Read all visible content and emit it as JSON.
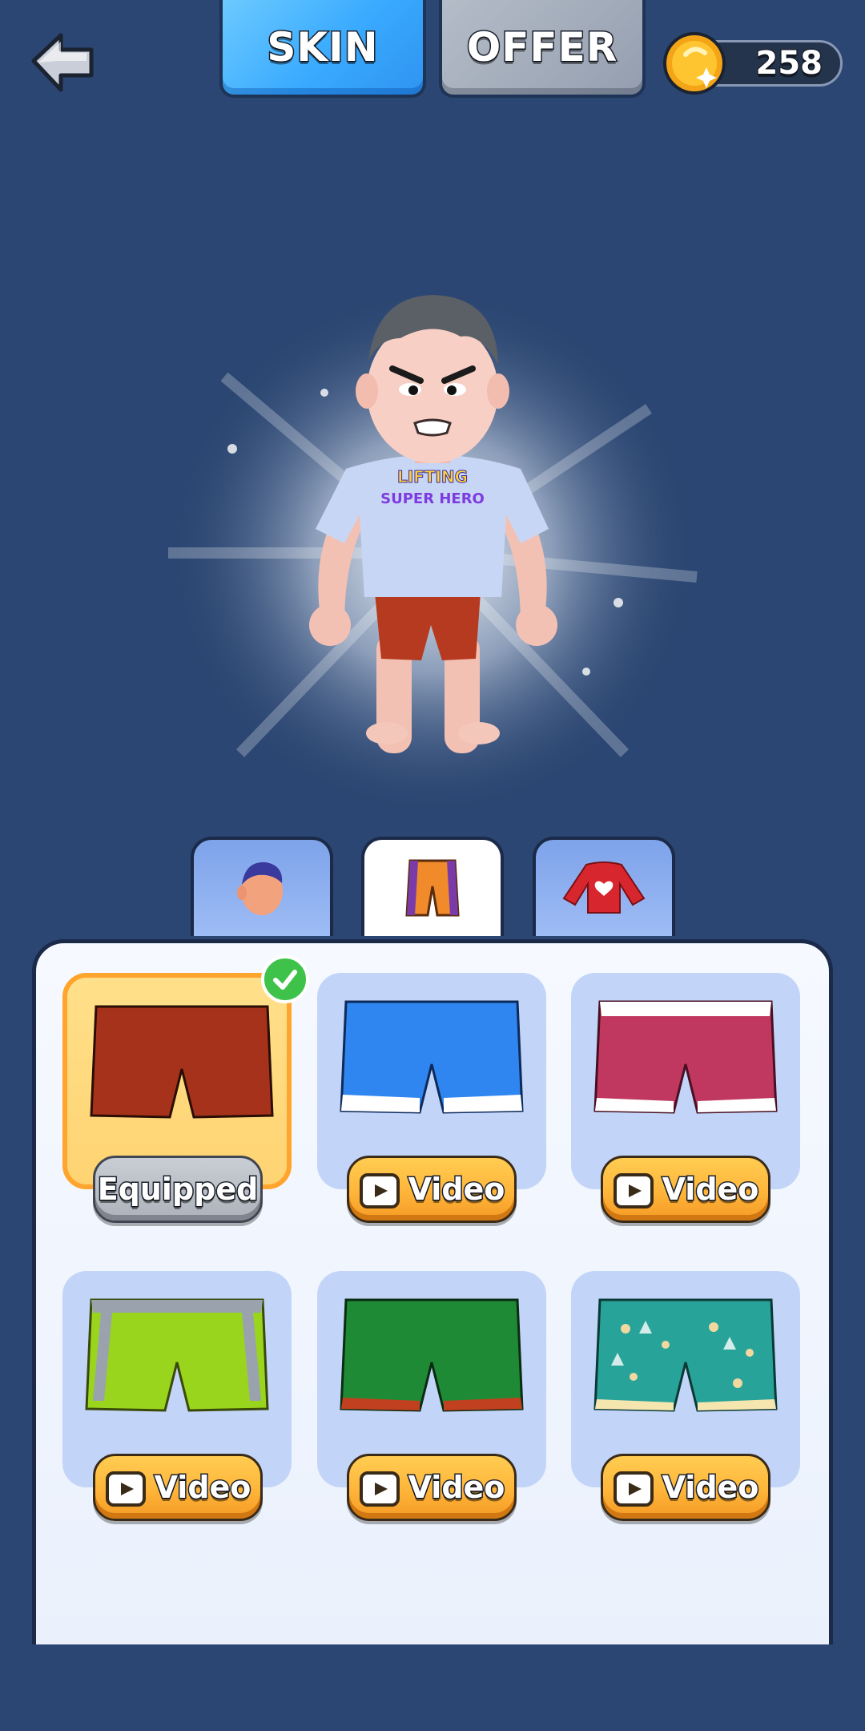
{
  "header": {
    "tabs": [
      {
        "label": "SKIN",
        "active": true
      },
      {
        "label": "OFFER",
        "active": false
      }
    ],
    "coins": "258",
    "back_icon": "back-arrow-icon",
    "coin_icon": "gold-coin-icon"
  },
  "character": {
    "shirt_line1": "LIFTING",
    "shirt_line2": "SUPER HERO"
  },
  "categories": [
    {
      "icon": "head-icon",
      "active": false
    },
    {
      "icon": "shorts-icon",
      "active": true
    },
    {
      "icon": "shirt-icon",
      "active": false
    }
  ],
  "items": [
    {
      "color": "#a7321b",
      "state": "equipped",
      "button_label": "Equipped"
    },
    {
      "color": "#2f86f0",
      "state": "video",
      "button_label": "Video"
    },
    {
      "color": "#c0385f",
      "state": "video",
      "button_label": "Video"
    },
    {
      "color": "#9ad51d",
      "state": "video",
      "button_label": "Video"
    },
    {
      "color": "#1f8a35",
      "state": "video",
      "button_label": "Video"
    },
    {
      "color": "#27a39a",
      "state": "video",
      "button_label": "Video"
    }
  ],
  "colors": {
    "background": "#2b4672",
    "skin_tab": "#39aaff",
    "offer_tab": "#a3acba",
    "video_button": "#ffb53a",
    "equipped_frame": "#ffa42c"
  }
}
